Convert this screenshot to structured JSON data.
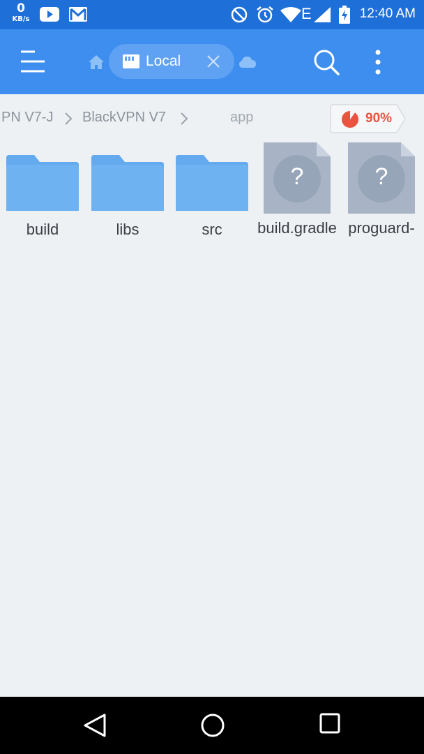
{
  "status_bar": {
    "speed_value": "0",
    "speed_unit": "KB/s",
    "network_type": "E",
    "time": "12:40 AM"
  },
  "app_bar": {
    "active_tab": "Local"
  },
  "breadcrumb": {
    "items": [
      "PN V7-J",
      "BlackVPN V7",
      "app"
    ]
  },
  "storage": {
    "used_percent_label": "90%",
    "used_fraction": 0.9
  },
  "files": [
    {
      "name": "build",
      "type": "folder"
    },
    {
      "name": "libs",
      "type": "folder"
    },
    {
      "name": "src",
      "type": "folder"
    },
    {
      "name": "build.gradle",
      "type": "unknown-file"
    },
    {
      "name": "proguard-",
      "type": "unknown-file"
    }
  ],
  "unknown_file_glyph": "?",
  "colors": {
    "status_bar": "#1f6fd8",
    "app_bar": "#3e8ef0",
    "folder": "#64aaee",
    "unknown_file": "#a8b4c6",
    "storage_accent": "#e9533f",
    "background": "#eef1f4"
  }
}
